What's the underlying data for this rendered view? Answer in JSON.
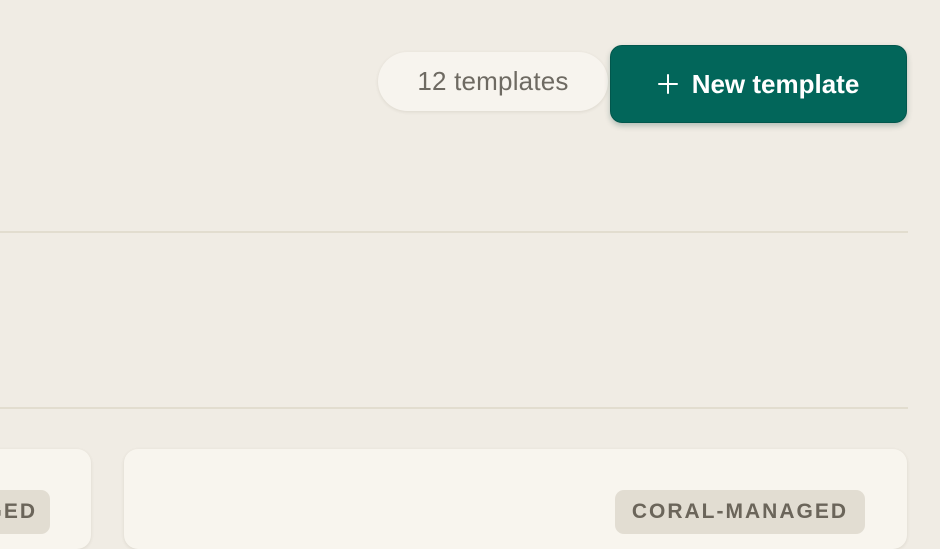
{
  "header": {
    "template_count_label": "12 templates",
    "new_template_button_label": "New template",
    "accent_color": "#02665a"
  },
  "cards": [
    {
      "badge": "CORAL-MANAGED"
    },
    {
      "badge": "CORAL-MANAGED"
    }
  ]
}
